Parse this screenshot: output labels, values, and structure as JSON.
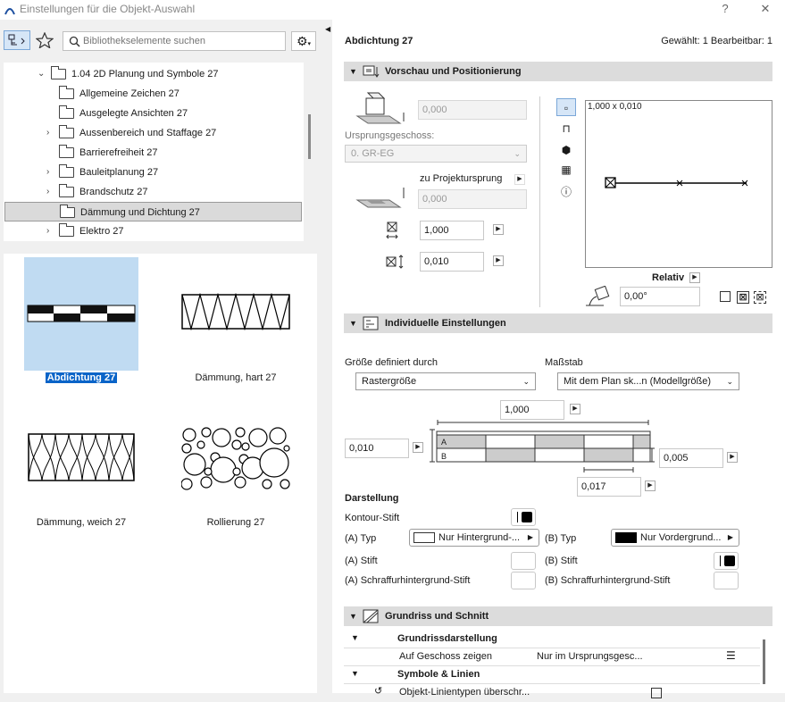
{
  "window": {
    "title": "Einstellungen für die Objekt-Auswahl",
    "help": "?",
    "close": "✕"
  },
  "left": {
    "search_placeholder": "Bibliothekselemente suchen",
    "tree": [
      {
        "label": "1.04 2D Planung und Symbole 27",
        "expanded": true
      },
      {
        "label": "Allgemeine Zeichen 27"
      },
      {
        "label": "Ausgelegte Ansichten 27"
      },
      {
        "label": "Aussenbereich und Staffage 27",
        "has_children": true
      },
      {
        "label": "Barrierefreiheit 27"
      },
      {
        "label": "Bauleitplanung 27",
        "has_children": true
      },
      {
        "label": "Brandschutz 27",
        "has_children": true
      },
      {
        "label": "Dämmung und Dichtung 27",
        "selected": true
      },
      {
        "label": "Elektro 27",
        "has_children": true
      }
    ],
    "items": [
      {
        "label": "Abdichtung 27",
        "selected": true
      },
      {
        "label": "Dämmung, hart 27"
      },
      {
        "label": "Dämmung, weich 27"
      },
      {
        "label": "Rollierung 27"
      }
    ]
  },
  "right": {
    "object_name": "Abdichtung 27",
    "selection_info": "Gewählt: 1 Bearbeitbar: 1",
    "sec1": "Vorschau und Positionierung",
    "elev1": "0,000",
    "origin_label": "Ursprungsgeschoss:",
    "origin_value": "0. GR-EG",
    "proj_label": "zu Projektursprung",
    "elev2": "0,000",
    "width": "1,000",
    "height": "0,010",
    "preview_label": "1,000 x 0,010",
    "relativ": "Relativ",
    "angle": "0,00°",
    "sec2": "Individuelle Einstellungen",
    "size_label": "Größe definiert durch",
    "size_value": "Rastergröße",
    "scale_label": "Maßstab",
    "scale_value": "Mit dem Plan sk...n (Modellgröße)",
    "dim_top": "1,000",
    "dim_left": "0,010",
    "dim_right": "0,005",
    "dim_bottom": "0,017",
    "row_a": "A",
    "row_b": "B",
    "darst": "Darstellung",
    "kontur": "Kontour-Stift",
    "a_typ": "(A) Typ",
    "a_typ_val": "Nur Hintergrund-...",
    "b_typ": "(B) Typ",
    "b_typ_val": "Nur Vordergrund...",
    "a_stift": "(A) Stift",
    "b_stift": "(B) Stift",
    "a_schraff": "(A) Schraffurhintergrund-Stift",
    "b_schraff": "(B) Schraffurhintergrund-Stift",
    "sec3": "Grundriss und Schnitt",
    "grp1": "Grundrissdarstellung",
    "geschoss_label": "Auf Geschoss zeigen",
    "geschoss_val": "Nur im Ursprungsgesc...",
    "grp2": "Symbole & Linien",
    "last_row": "Objekt-Linientypen überschr..."
  }
}
